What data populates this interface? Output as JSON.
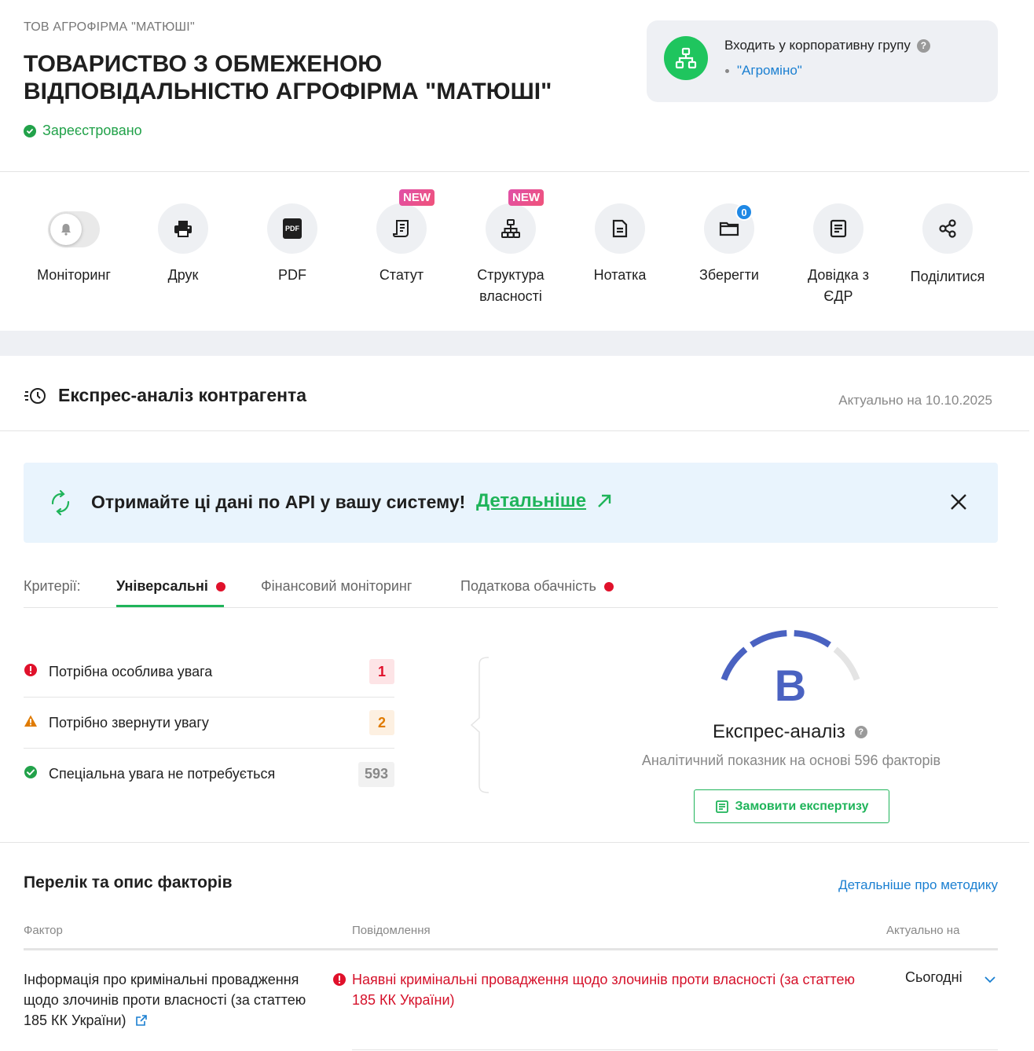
{
  "company": {
    "short_name": "ТОВ АГРОФІРМА \"МАТЮШІ\"",
    "full_name": "ТОВАРИСТВО З ОБМЕЖЕНОЮ ВІДПОВІДАЛЬНІСТЮ АГРОФІРМА \"МАТЮШІ\"",
    "status": "Зареєстровано"
  },
  "group": {
    "title": "Входить у корпоративну групу",
    "help": "?",
    "link": "\"Агроміно\""
  },
  "toolbar": {
    "items": [
      {
        "label": "Моніторинг",
        "icon": "bell-icon"
      },
      {
        "label": "Друк",
        "icon": "printer-icon"
      },
      {
        "label": "PDF",
        "icon": "pdf-icon",
        "icon_text": "PDF"
      },
      {
        "label": "Статут",
        "icon": "document-scroll-icon",
        "badge": "NEW"
      },
      {
        "label": "Структура власності",
        "icon": "hierarchy-icon",
        "badge": "NEW"
      },
      {
        "label": "Нотатка",
        "icon": "note-icon"
      },
      {
        "label": "Зберегти",
        "icon": "folder-icon",
        "count": "0"
      },
      {
        "label": "Довідка з ЄДР",
        "icon": "certificate-icon"
      },
      {
        "label": "Поділитися",
        "icon": "share-icon"
      }
    ]
  },
  "express": {
    "title": "Експрес-аналіз контрагента",
    "date": "Актуально на 10.10.2025"
  },
  "api_banner": {
    "text": "Отримайте ці дані по API у вашу систему!",
    "link": "Детальніше"
  },
  "tabs": {
    "label": "Критерії:",
    "items": [
      {
        "label": "Універсальні",
        "active": true,
        "alert": true
      },
      {
        "label": "Фінансовий моніторинг",
        "active": false,
        "alert": false
      },
      {
        "label": "Податкова обачність",
        "active": false,
        "alert": true
      }
    ]
  },
  "criteria": [
    {
      "label": "Потрібна особлива увага",
      "count": "1",
      "level": "critical",
      "color": "#e0112b",
      "bg": "#fde4e6"
    },
    {
      "label": "Потрібно звернути увагу",
      "count": "2",
      "level": "warning",
      "color": "#e07b00",
      "bg": "#fdf0e1"
    },
    {
      "label": "Спеціальна увага не потребується",
      "count": "593",
      "level": "ok",
      "color": "#888888",
      "bg": "#f1f1f1"
    }
  ],
  "score": {
    "grade": "B",
    "title": "Експрес-аналіз",
    "help": "?",
    "subtitle": "Аналітичний показник на основі 596 факторів",
    "order_button": "Замовити експертизу",
    "filled_segments": 3,
    "total_segments": 4,
    "color": "#4a62c1"
  },
  "factors": {
    "title": "Перелік та опис факторів",
    "method_link": "Детальніше про методику",
    "headers": {
      "factor": "Фактор",
      "message": "Повідомлення",
      "date": "Актуально на"
    },
    "rows": [
      {
        "factor": "Інформація про кримінальні провадження щодо злочинів проти власності (за статтею 185 КК України)",
        "message": "Наявні кримінальні провадження щодо злочинів проти власності (за статтею 185 КК України)",
        "date": "Сьогодні"
      }
    ]
  }
}
